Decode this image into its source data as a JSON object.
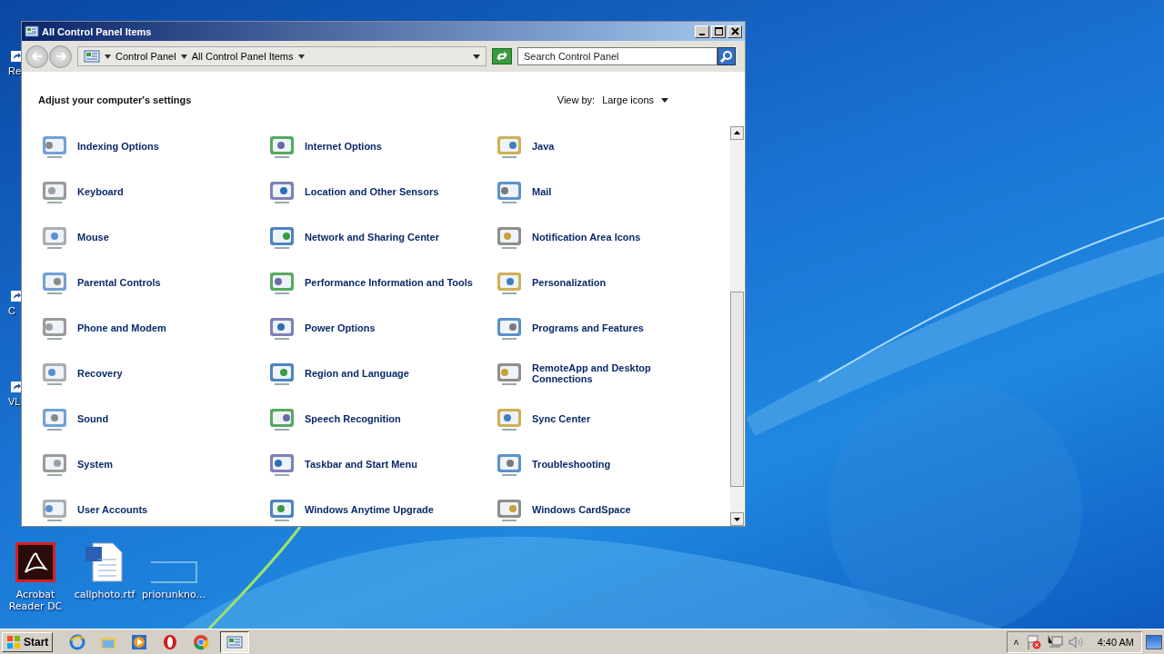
{
  "desktop": {
    "icons_top": [
      {
        "label": "Re"
      },
      {
        "label": "C"
      },
      {
        "label": "VL"
      }
    ],
    "icons_bottom": [
      {
        "label": "Acrobat Reader DC",
        "kind": "acrobat",
        "selected": false
      },
      {
        "label": "callphoto.rtf",
        "kind": "word",
        "selected": false
      },
      {
        "label": "priorunkno...",
        "kind": "blank",
        "selected": false
      }
    ]
  },
  "window": {
    "title": "All Control Panel Items",
    "breadcrumb": [
      "Control Panel",
      "All Control Panel Items"
    ],
    "search": {
      "placeholder": "Search Control Panel"
    },
    "heading": "Adjust your computer's settings",
    "view_by": {
      "label": "View by:",
      "value": "Large icons"
    },
    "items": [
      {
        "label": "Indexing Options"
      },
      {
        "label": "Internet Options"
      },
      {
        "label": "Java"
      },
      {
        "label": "Keyboard"
      },
      {
        "label": "Location and Other Sensors"
      },
      {
        "label": "Mail"
      },
      {
        "label": "Mouse"
      },
      {
        "label": "Network and Sharing Center"
      },
      {
        "label": "Notification Area Icons"
      },
      {
        "label": "Parental Controls"
      },
      {
        "label": "Performance Information and Tools"
      },
      {
        "label": "Personalization"
      },
      {
        "label": "Phone and Modem"
      },
      {
        "label": "Power Options"
      },
      {
        "label": "Programs and Features"
      },
      {
        "label": "Recovery"
      },
      {
        "label": "Region and Language"
      },
      {
        "label": "RemoteApp and Desktop Connections"
      },
      {
        "label": "Sound"
      },
      {
        "label": "Speech Recognition"
      },
      {
        "label": "Sync Center"
      },
      {
        "label": "System"
      },
      {
        "label": "Taskbar and Start Menu"
      },
      {
        "label": "Troubleshooting"
      },
      {
        "label": "User Accounts"
      },
      {
        "label": "Windows Anytime Upgrade"
      },
      {
        "label": "Windows CardSpace"
      }
    ]
  },
  "taskbar": {
    "start": "Start",
    "apps": [
      {
        "kind": "ie",
        "active": false
      },
      {
        "kind": "folder",
        "active": false
      },
      {
        "kind": "media",
        "active": false
      },
      {
        "kind": "opera",
        "active": false
      },
      {
        "kind": "chrome",
        "active": false
      },
      {
        "kind": "control",
        "active": true
      }
    ],
    "tray": {
      "expand": "˄",
      "clock": "4:40 AM"
    }
  }
}
